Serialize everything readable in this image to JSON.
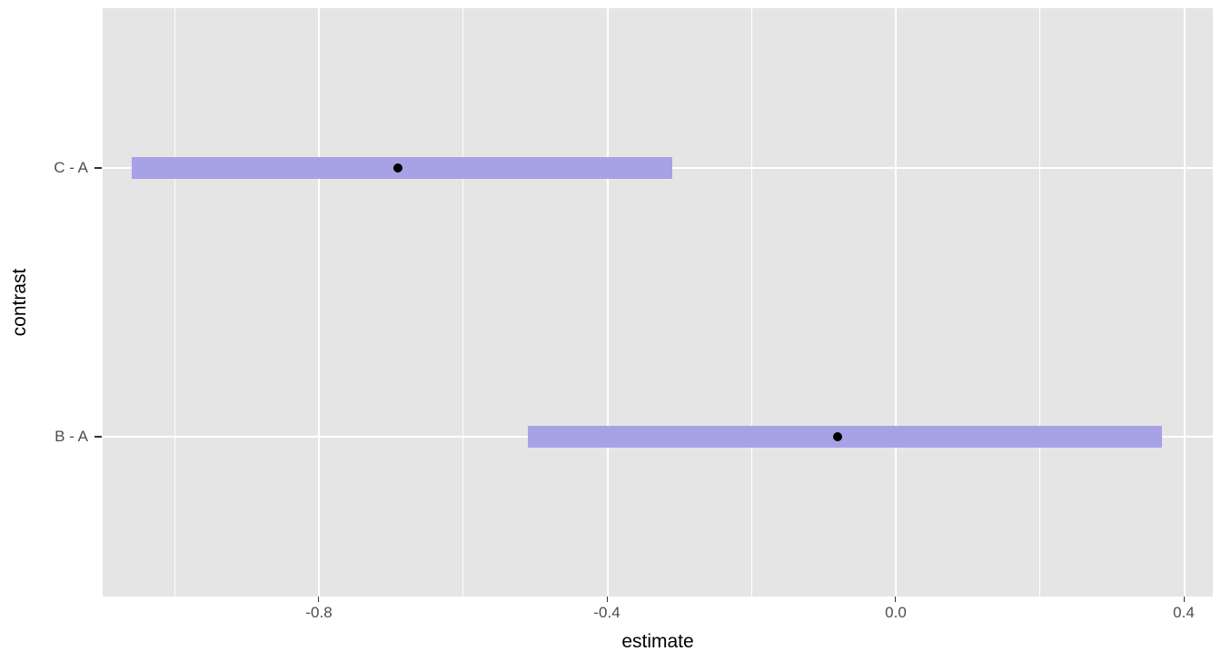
{
  "chart_data": {
    "type": "interval",
    "title": "",
    "xlabel": "estimate",
    "ylabel": "contrast",
    "xlim": [
      -1.1,
      0.44
    ],
    "x_ticks": [
      -0.8,
      -0.4,
      0.0,
      0.4
    ],
    "x_minor_ticks": [
      -1.0,
      -0.6,
      -0.2,
      0.2
    ],
    "categories": [
      "B - A",
      "C - A"
    ],
    "series": [
      {
        "name": "B - A",
        "estimate": -0.08,
        "lower": -0.51,
        "upper": 0.37
      },
      {
        "name": "C - A",
        "estimate": -0.69,
        "lower": -1.06,
        "upper": -0.27
      }
    ],
    "bar_color": "#a7a2e6",
    "point_color": "#000000",
    "panel_bg": "#e5e5e5"
  },
  "axis": {
    "xlabel": "estimate",
    "ylabel": "contrast",
    "x_tick_labels": [
      "-0.8",
      "-0.4",
      "0.0",
      "0.4"
    ],
    "y_tick_labels": [
      "B - A",
      "C - A"
    ]
  }
}
